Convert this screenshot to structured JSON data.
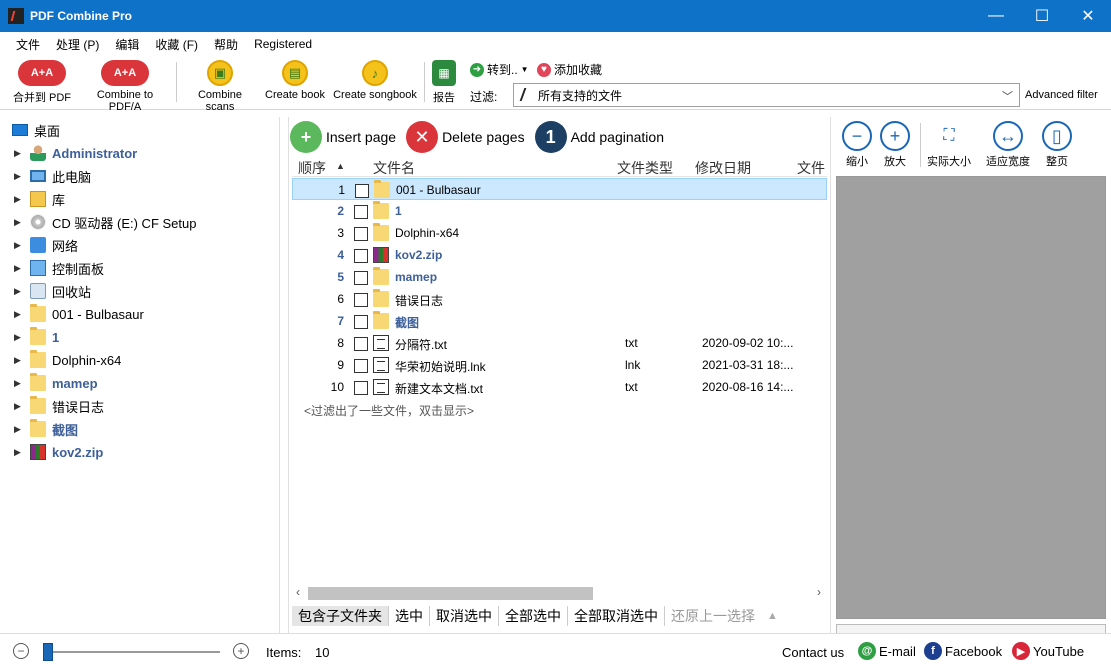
{
  "app": {
    "title": "PDF Combine Pro"
  },
  "window_controls": {
    "minimize": "—",
    "maximize": "☐",
    "close": "✕"
  },
  "menu": [
    "文件",
    "处理 (P)",
    "编辑",
    "收藏 (F)",
    "帮助",
    "Registered"
  ],
  "toolbar": {
    "merge_pdf": "合并到 PDF",
    "combine_pdfa": "Combine to PDF/A",
    "combine_scans": "Combine scans",
    "create_book": "Create book",
    "create_songbook": "Create songbook",
    "report": "报告",
    "goto": "转到..",
    "add_favorite": "添加收藏",
    "filter_label": "过滤:",
    "filter_value": "所有支持的文件",
    "advanced_filter": "Advanced filter"
  },
  "tree": [
    {
      "label": "桌面",
      "icon": "desktop-icon",
      "bold": false
    },
    {
      "label": "Administrator",
      "icon": "user-icon",
      "bold": true
    },
    {
      "label": "此电脑",
      "icon": "computer-icon",
      "bold": false
    },
    {
      "label": "库",
      "icon": "library-icon",
      "bold": false
    },
    {
      "label": "CD 驱动器 (E:) CF Setup",
      "icon": "cd-drive-icon",
      "bold": false
    },
    {
      "label": "网络",
      "icon": "network-icon",
      "bold": false
    },
    {
      "label": "控制面板",
      "icon": "control-panel-icon",
      "bold": false
    },
    {
      "label": "回收站",
      "icon": "recycle-bin-icon",
      "bold": false
    },
    {
      "label": "001 - Bulbasaur",
      "icon": "folder-icon",
      "bold": false
    },
    {
      "label": "1",
      "icon": "folder-icon",
      "bold": true
    },
    {
      "label": "Dolphin-x64",
      "icon": "folder-icon",
      "bold": false
    },
    {
      "label": "mamep",
      "icon": "folder-icon",
      "bold": true
    },
    {
      "label": "错误日志",
      "icon": "folder-icon",
      "bold": false
    },
    {
      "label": "截图",
      "icon": "folder-icon",
      "bold": true
    },
    {
      "label": "kov2.zip",
      "icon": "zip-icon",
      "bold": true
    }
  ],
  "actions": {
    "insert_page": "Insert page",
    "delete_pages": "Delete pages",
    "add_pagination": "Add pagination"
  },
  "grid": {
    "headers": {
      "order": "顺序",
      "name": "文件名",
      "type": "文件类型",
      "date": "修改日期",
      "extra": "文件"
    },
    "rows": [
      {
        "num": "1",
        "name": "001 - Bulbasaur",
        "type": "",
        "date": "",
        "icon": "folder",
        "bold": false
      },
      {
        "num": "2",
        "name": "1",
        "type": "",
        "date": "",
        "icon": "folder",
        "bold": true
      },
      {
        "num": "3",
        "name": "Dolphin-x64",
        "type": "",
        "date": "",
        "icon": "folder",
        "bold": false
      },
      {
        "num": "4",
        "name": "kov2.zip",
        "type": "",
        "date": "",
        "icon": "zip",
        "bold": true
      },
      {
        "num": "5",
        "name": "mamep",
        "type": "",
        "date": "",
        "icon": "folder",
        "bold": true
      },
      {
        "num": "6",
        "name": "错误日志",
        "type": "",
        "date": "",
        "icon": "folder",
        "bold": false
      },
      {
        "num": "7",
        "name": "截图",
        "type": "",
        "date": "",
        "icon": "folder",
        "bold": true
      },
      {
        "num": "8",
        "name": "分隔符.txt",
        "type": "txt",
        "date": "2020-09-02 10:...",
        "icon": "doc",
        "bold": false
      },
      {
        "num": "9",
        "name": "华荣初始说明.lnk",
        "type": "lnk",
        "date": "2021-03-31 18:...",
        "icon": "doc",
        "bold": false
      },
      {
        "num": "10",
        "name": "新建文本文档.txt",
        "type": "txt",
        "date": "2020-08-16 14:...",
        "icon": "doc",
        "bold": false
      }
    ],
    "filtered_note": "<过滤出了一些文件，双击显示>"
  },
  "bottom_tabs": [
    "包含子文件夹",
    "选中",
    "取消选中",
    "全部选中",
    "全部取消选中",
    "还原上一选择"
  ],
  "preview_tools": [
    "缩小",
    "放大",
    "实际大小",
    "适应宽度",
    "整页"
  ],
  "status": {
    "items_label": "Items:",
    "items_count": "10",
    "contact": "Contact us",
    "email": "E-mail",
    "facebook": "Facebook",
    "youtube": "YouTube"
  }
}
